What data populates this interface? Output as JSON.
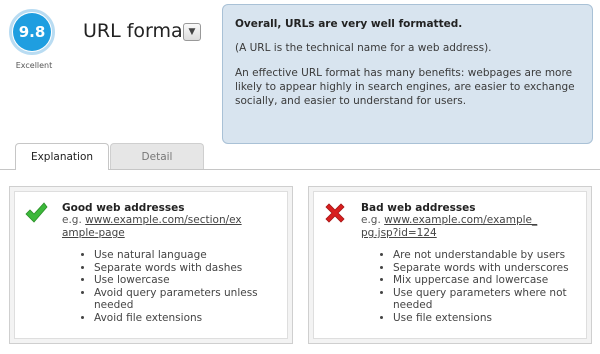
{
  "score": {
    "value": "9.8",
    "label": "Excellent"
  },
  "header": {
    "title": "URL format"
  },
  "summary": {
    "headline": "Overall, URLs are very well formatted.",
    "paragraphs": [
      "(A URL is the technical name for a web address).",
      "An effective URL format has many benefits: webpages are more likely to appear highly in search engines, are easier to exchange socially, and easier to understand for users."
    ]
  },
  "tabs": [
    {
      "label": "Explanation",
      "active": true
    },
    {
      "label": "Detail",
      "active": false
    }
  ],
  "good": {
    "icon": "check-icon",
    "title": "Good web addresses",
    "example_prefix": "e.g.",
    "example_url": "www.example.com/section/example-page",
    "items": [
      "Use natural language",
      "Separate words with dashes",
      "Use lowercase",
      "Avoid query parameters unless needed",
      "Avoid file extensions"
    ],
    "color": "#3cb83a"
  },
  "bad": {
    "icon": "cross-icon",
    "title": "Bad web addresses",
    "example_prefix": "e.g.",
    "example_url": "www.example.com/example_pg.jsp?id=124",
    "items": [
      "Are not understandable by users",
      "Separate words with underscores",
      "Mix uppercase and lowercase",
      "Use query parameters where not needed",
      "Use file extensions"
    ],
    "color": "#d81f1f"
  },
  "colors": {
    "score_blue": "#1f9ee0",
    "summary_bg": "#d8e4ef"
  }
}
